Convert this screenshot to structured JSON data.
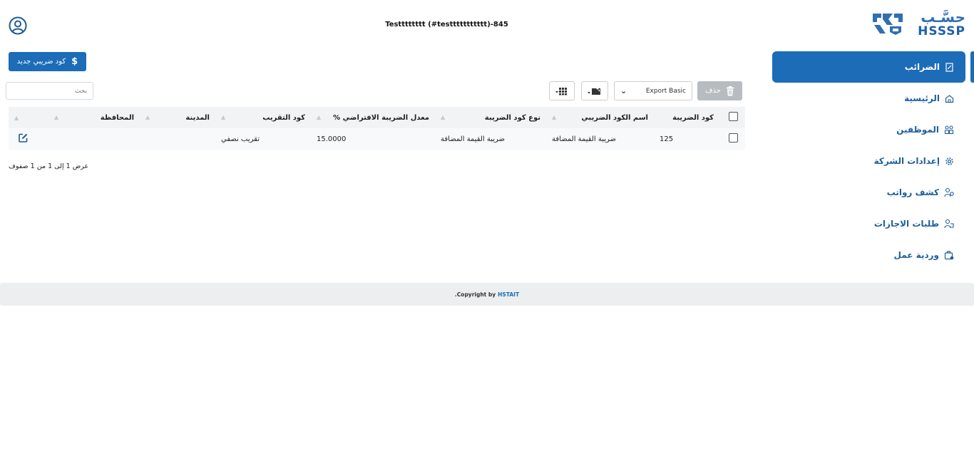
{
  "header": {
    "company_title": "Testttttttt (#testtttttttttt)-845",
    "logo_arabic": "حسَّـب",
    "logo_english": "HSSSP"
  },
  "sidebar": {
    "items": [
      {
        "label": "الضرائب",
        "icon": "receipt-icon",
        "active": true
      },
      {
        "label": "الرئيسية",
        "icon": "home-icon",
        "active": false
      },
      {
        "label": "الموظفين",
        "icon": "employees-icon",
        "active": false
      },
      {
        "label": "إعدادات الشركة",
        "icon": "gear-icon",
        "active": false
      },
      {
        "label": "كشف رواتب",
        "icon": "payroll-icon",
        "active": false
      },
      {
        "label": "طلبات الاجازات",
        "icon": "leave-request-icon",
        "active": false
      },
      {
        "label": "وردية عمل",
        "icon": "shift-icon",
        "active": false
      }
    ]
  },
  "toolbar": {
    "new_tax_label": "كود ضريبي جديد",
    "delete_label": "حذف",
    "export_select_value": "Export Basic",
    "search_placeholder": "بحث"
  },
  "table": {
    "columns": [
      "كود الضريبة",
      "اسم الكود الضريبي",
      "نوع كود الضريبة",
      "معدل الضريبة الافتراضي %",
      "كود التقريب",
      "المدينة",
      "المحافظة"
    ],
    "rows": [
      [
        "125",
        "ضريبة القيمة المضافة",
        "ضريبة القيمة المضافة",
        "15.0000",
        "تقريب نصفي",
        "",
        ""
      ]
    ],
    "info": "عرض 1 إلى 1 من 1 صفوف"
  },
  "footer": {
    "copyright_prefix": "Copyright by",
    "brand": "HSTAIT",
    "suffix": "."
  },
  "colors": {
    "primary": "#1c6cb8",
    "sidebar_text": "#1e5f9e",
    "disabled_button": "#b7bcc0",
    "footer_bg": "#eceef0"
  }
}
